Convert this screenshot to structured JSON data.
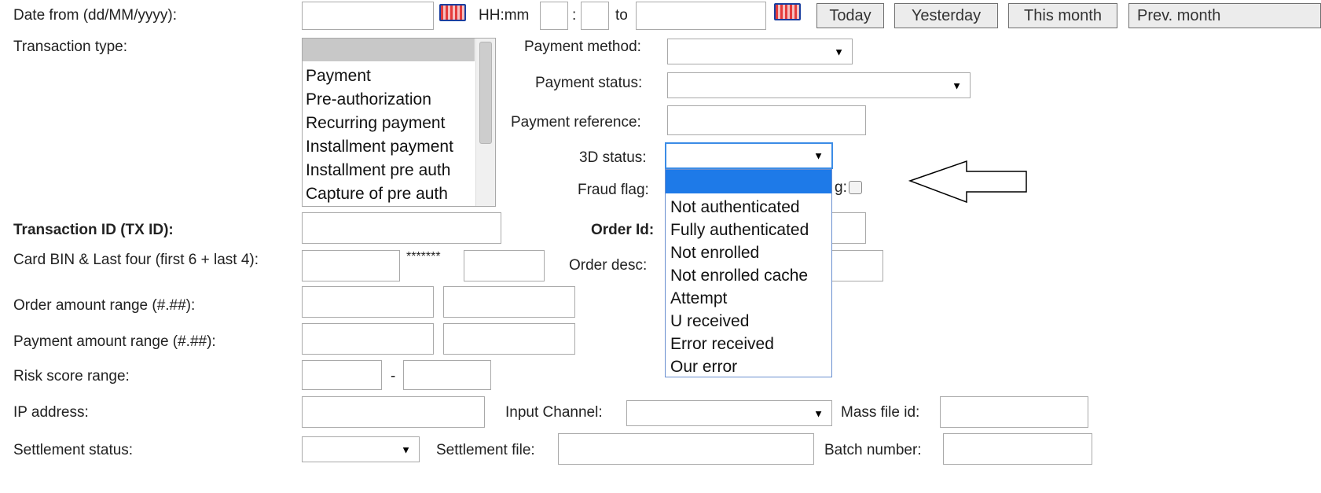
{
  "labels": {
    "date_from": "Date from (dd/MM/yyyy):",
    "hhmm": "HH:mm",
    "colon": ":",
    "to": "to",
    "transaction_type": "Transaction type:",
    "payment_method": "Payment method:",
    "payment_status": "Payment status:",
    "payment_reference": "Payment reference:",
    "three_d_status": "3D status:",
    "fraud_flag": "Fraud flag:",
    "partial_flag_suffix": "g:",
    "transaction_id": "Transaction ID (TX ID):",
    "order_id": "Order Id:",
    "card_bin": "Card BIN & Last four (first 6 + last 4):",
    "masked": "*******",
    "order_desc": "Order desc:",
    "order_amount_range": "Order amount range (#.##):",
    "payment_amount_range": "Payment amount range (#.##):",
    "risk_score_range": "Risk score range:",
    "risk_dash": "-",
    "ip_address": "IP address:",
    "input_channel": "Input Channel:",
    "mass_file_id": "Mass file id:",
    "settlement_status": "Settlement status:",
    "settlement_file": "Settlement file:",
    "batch_number": "Batch number:"
  },
  "buttons": {
    "today": "Today",
    "yesterday": "Yesterday",
    "this_month": "This month",
    "prev_month": "Prev. month"
  },
  "transaction_types": [
    "",
    "Payment",
    "Pre-authorization",
    "Recurring payment",
    "Installment payment",
    "Installment pre auth",
    "Capture of pre auth"
  ],
  "three_d_options": [
    "",
    "Not authenticated",
    "Fully authenticated",
    "Not enrolled",
    "Not enrolled cache",
    "Attempt",
    "U received",
    "Error received",
    "Our error"
  ],
  "icons": {
    "dropdown_arrow": "▼",
    "calendar": "calendar-icon",
    "annotation_arrow": "left-arrow-icon"
  },
  "colors": {
    "highlight": "#1e7ae8",
    "list_selected": "#c8c8c8"
  }
}
